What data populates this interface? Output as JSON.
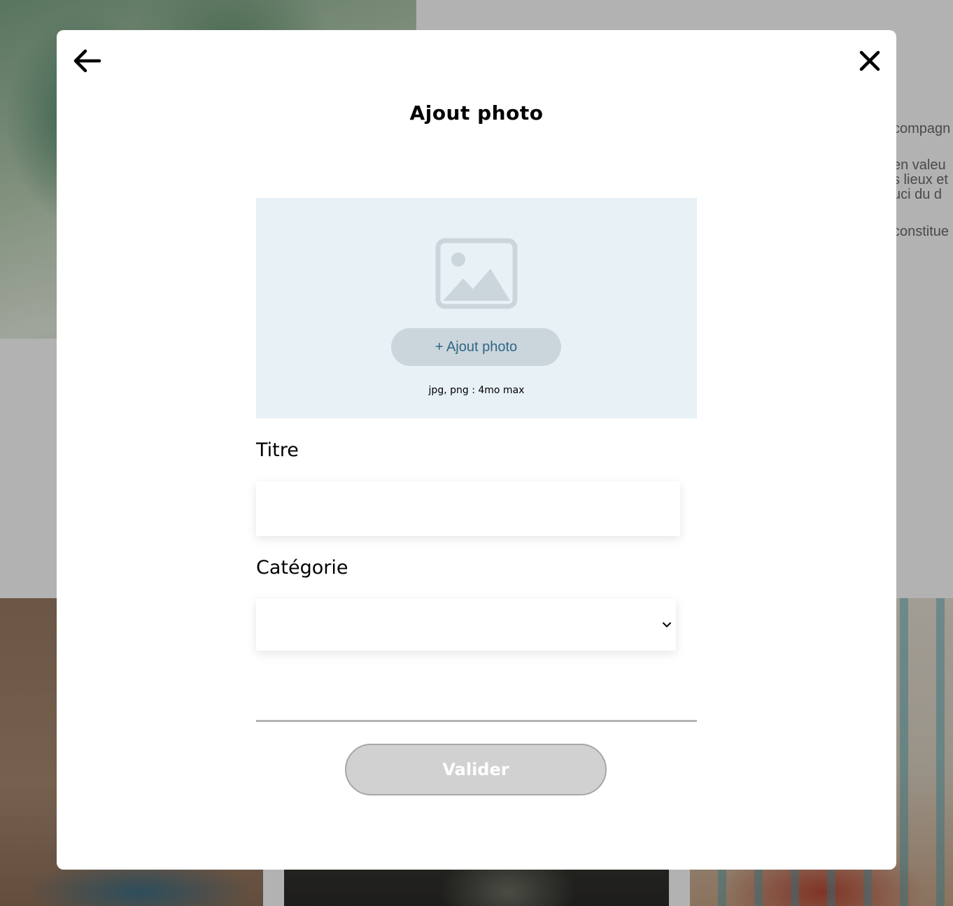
{
  "background": {
    "side_text_lines": [
      "compagn",
      "en valeu",
      "s lieux et",
      "uci du d",
      "constitue"
    ]
  },
  "modal": {
    "title": "Ajout photo",
    "back_icon": "arrow-left-icon",
    "close_icon": "close-icon",
    "upload": {
      "icon": "image-placeholder-icon",
      "button_label": "+ Ajout photo",
      "hint": "jpg, png : 4mo max"
    },
    "fields": {
      "title_label": "Titre",
      "title_value": "",
      "category_label": "Catégorie",
      "category_value": ""
    },
    "submit_label": "Valider"
  },
  "colors": {
    "upload_zone_bg": "#e8f1f6",
    "upload_button_bg": "#cbd6dc",
    "upload_button_text": "#306685",
    "submit_disabled_bg": "#d1d1d1"
  }
}
